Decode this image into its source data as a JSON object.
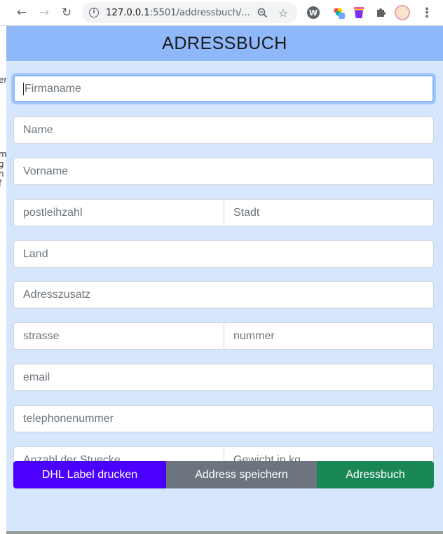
{
  "browser": {
    "url_host": "127.0.0.1",
    "url_rest": ":5501/addressbuch/...",
    "icons": {
      "back": "arrow-left-icon",
      "forward": "arrow-right-icon",
      "reload": "reload-icon",
      "info": "info-icon",
      "zoom": "zoom-icon",
      "star": "star-icon",
      "extensions": "puzzle-icon",
      "menu": "kebab-menu-icon"
    }
  },
  "sliver": [
    "er",
    "m",
    "g",
    "n",
    "f"
  ],
  "app": {
    "title": "ADRESSBUCH",
    "colors": {
      "header": "#8fb8fb",
      "background": "#d6e6fd",
      "dhl_button": "#4b00ff",
      "save_button": "#6c757d",
      "book_button": "#198754"
    },
    "fields": {
      "firmaname": "Firmaname",
      "name": "Name",
      "vorname": "Vorname",
      "postleihzahl": "postleihzahl",
      "stadt": "Stadt",
      "land": "Land",
      "adresszusatz": "Adresszusatz",
      "strasse": "strasse",
      "nummer": "nummer",
      "email": "email",
      "telephonenummer": "telephonenummer",
      "anzahl": "Anzahl der Stuecke",
      "gewicht": "Gewicht in kg"
    },
    "buttons": {
      "dhl": "DHL Label drucken",
      "save": "Address speichern",
      "book": "Adressbuch"
    }
  }
}
